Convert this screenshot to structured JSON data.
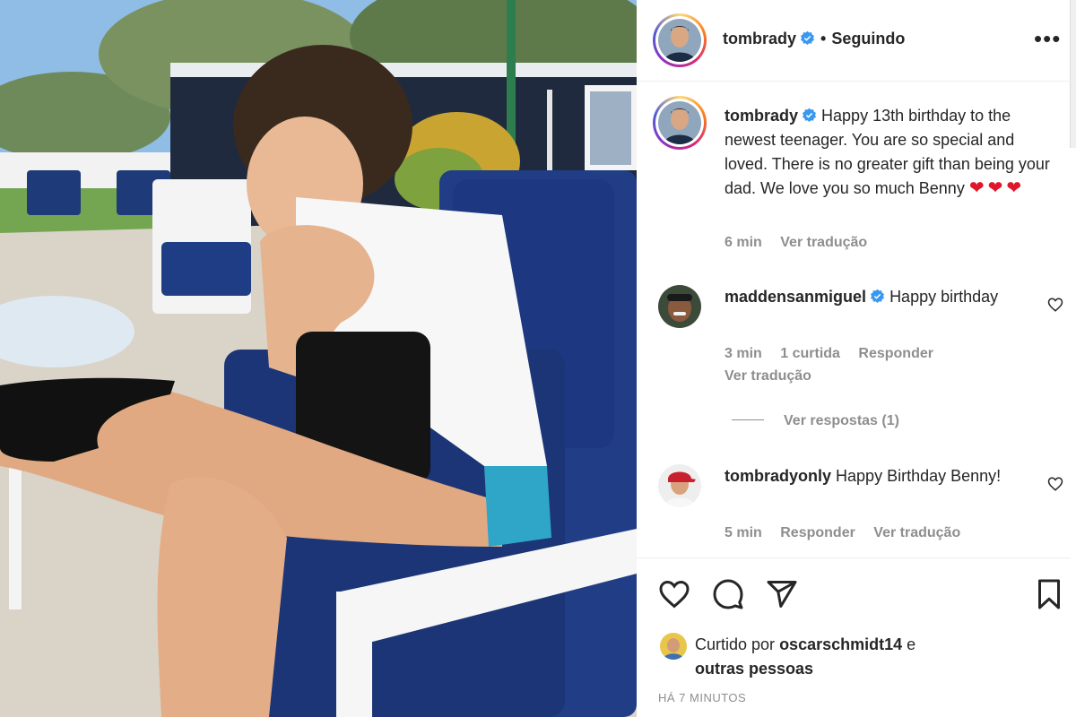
{
  "post": {
    "username": "tombrady",
    "follow_status": "Seguindo",
    "more_label": "•••",
    "caption_text": "Happy 13th birthday to the newest teenager. You are so special and loved. There is no greater gift than being your dad. We love you so much Benny",
    "caption_hearts": "❤❤❤",
    "caption_time": "6 min",
    "caption_translate": "Ver tradução",
    "photo_alt": "Boy in white t-shirt sitting on a blue cushioned patio chair outdoors"
  },
  "comments": [
    {
      "username": "maddensanmiguel",
      "verified": true,
      "text": "Happy birthday",
      "time": "3 min",
      "likes": "1 curtida",
      "reply": "Responder",
      "translate": "Ver tradução",
      "view_replies": "Ver respostas (1)"
    },
    {
      "username": "tombradyonly",
      "verified": false,
      "text": "Happy Birthday Benny!",
      "time": "5 min",
      "reply": "Responder",
      "translate": "Ver tradução"
    }
  ],
  "footer": {
    "liked_by_prefix": "Curtido por",
    "liked_by_user": "oscarschmidt14",
    "liked_by_suffix": "e",
    "liked_by_others": "outras pessoas",
    "timestamp": "HÁ 7 MINUTOS"
  },
  "icons": {
    "like": "heart-icon",
    "comment": "comment-icon",
    "share": "send-icon",
    "save": "bookmark-icon",
    "verified": "verified-badge-icon"
  },
  "colors": {
    "verified": "#3897f0",
    "heart": "#e0162b",
    "muted": "#8e8e8e",
    "text": "#262626"
  }
}
